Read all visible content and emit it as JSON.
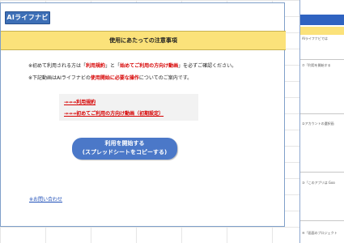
{
  "header": {
    "logo_text": "AIライフナビ",
    "notice_title": "使用にあたっての注意事項"
  },
  "instructions": [
    {
      "prefix": "※初めて利用される方は「",
      "red1": "利用規約",
      "mid": "」と「",
      "red2": "始めてご利用の方向け動画",
      "suffix": "」を必ずご確認ください。"
    },
    {
      "prefix": "※下記動画はAIライフナビの",
      "red1": "使用開始に必要な操作",
      "suffix": "についてのご案内です。"
    }
  ],
  "links": [
    "→→→利用規約",
    "→→→初めてご利用の方向け動画（初期設定）"
  ],
  "start_button": {
    "line1": "利用を開始する",
    "line2": "(スプレッドシートをコピーする)"
  },
  "contact_link": "※お問い合わせ",
  "side_panel": {
    "blocks": [
      "AIライフナビでは",
      "⑦「利用を開始する",
      "②アカウントの選択画",
      "③「このアプリは Goo",
      "④「画面のプロジェクト"
    ]
  },
  "colors": {
    "accent_blue": "#4b78c8",
    "notice_yellow": "#fbe27a",
    "emphasis_red": "#d60000"
  }
}
